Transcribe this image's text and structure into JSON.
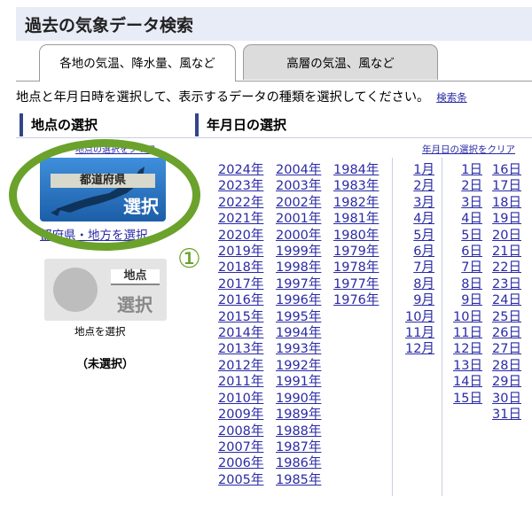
{
  "title": "過去の気象データ検索",
  "tabs": [
    {
      "label": "各地の気温、降水量、風など",
      "active": true
    },
    {
      "label": "高層の気温、風など",
      "active": false
    }
  ],
  "instruction": "地点と年月日時を選択して、表示するデータの種類を選択してください。",
  "instruction_link": "検索条",
  "section_left": "地点の選択",
  "section_right": "年月日の選択",
  "clear_point_cut": "地点の選択をクリア",
  "clear_date": "年月日の選択をクリア",
  "pref_button": {
    "label": "都道府県",
    "select": "選択"
  },
  "pref_link": "都府県・地方を選択",
  "annotation": "①",
  "point_button": {
    "label": "地点",
    "select": "選択"
  },
  "point_caption": "地点を選択",
  "unselected": "（未選択）",
  "years_col1": [
    "2024年",
    "2023年",
    "2022年",
    "2021年",
    "2020年",
    "2019年",
    "2018年",
    "2017年",
    "2016年",
    "2015年",
    "2014年",
    "2013年",
    "2012年",
    "2011年",
    "2010年",
    "2009年",
    "2008年",
    "2007年",
    "2006年",
    "2005年"
  ],
  "years_col2": [
    "2004年",
    "2003年",
    "2002年",
    "2001年",
    "2000年",
    "1999年",
    "1998年",
    "1997年",
    "1996年",
    "1995年",
    "1994年",
    "1993年",
    "1992年",
    "1991年",
    "1990年",
    "1989年",
    "1988年",
    "1987年",
    "1986年",
    "1985年"
  ],
  "years_col3": [
    "1984年",
    "1983年",
    "1982年",
    "1981年",
    "1980年",
    "1979年",
    "1978年",
    "1977年",
    "1976年"
  ],
  "months": [
    "1月",
    "2月",
    "3月",
    "4月",
    "5月",
    "6月",
    "7月",
    "8月",
    "9月",
    "10月",
    "11月",
    "12月"
  ],
  "days_col1": [
    "1日",
    "2日",
    "3日",
    "4日",
    "5日",
    "6日",
    "7日",
    "8日",
    "9日",
    "10日",
    "11日",
    "12日",
    "13日",
    "14日",
    "15日"
  ],
  "days_col2": [
    "16日",
    "17日",
    "18日",
    "19日",
    "20日",
    "21日",
    "22日",
    "23日",
    "24日",
    "25日",
    "26日",
    "27日",
    "28日",
    "29日",
    "30日",
    "31日"
  ],
  "colors": {
    "accent_green": "#6aa22b",
    "link": "#2a2aa6",
    "title_bg": "#e7ecf7"
  }
}
